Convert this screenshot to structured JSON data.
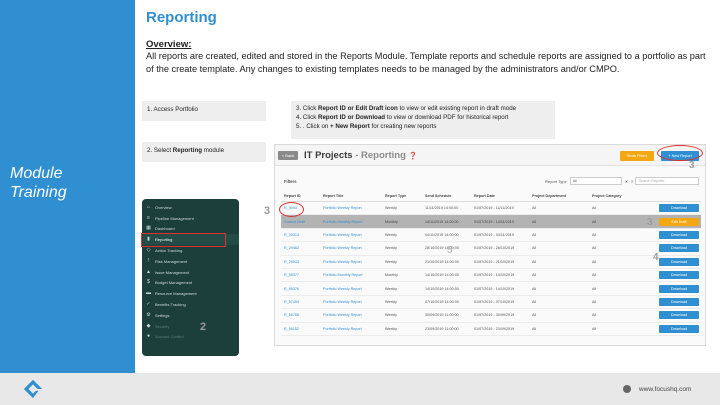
{
  "page": {
    "title": "Reporting",
    "overview_heading": "Overview:",
    "overview_text": "All reports are created, edited and stored in the Reports Module. Template reports and schedule reports are assigned to a portfolio as part of the create template.  Any changes to existing templates needs to be managed by the administrators and/or CMPO."
  },
  "side_label": {
    "line1": "Module",
    "line2": "Training"
  },
  "steps": {
    "step1": "1. Access Portfolio",
    "step2_prefix": "2. Select ",
    "step2_bold": "Reporting",
    "step2_suffix": " module",
    "step3_prefix": "3. Click ",
    "step3_bold": "Report ID or Edit Draft icon",
    "step3_suffix": " to view or edit existing report in draft mode",
    "step4_prefix": "4. Click ",
    "step4_bold": "Report ID or Download",
    "step4_suffix": " to view or download PDF for historical report",
    "step5_prefix": "5. . Click on ",
    "step5_bold": "+ New Report",
    "step5_suffix": " for creating new reports"
  },
  "sidebar": {
    "items": [
      {
        "label": "Overview",
        "icon": "home-icon"
      },
      {
        "label": "Pipeline Management",
        "icon": "pipeline-icon"
      },
      {
        "label": "Dashboard",
        "icon": "dashboard-icon"
      },
      {
        "label": "Reporting",
        "icon": "chart-icon",
        "active": true
      },
      {
        "label": "Action Tracking",
        "icon": "action-icon"
      },
      {
        "label": "Risk Management",
        "icon": "risk-icon"
      },
      {
        "label": "Issue Management",
        "icon": "issue-icon"
      },
      {
        "label": "Budget Management",
        "icon": "budget-icon"
      },
      {
        "label": "Resource Management",
        "icon": "resource-icon"
      },
      {
        "label": "Benefits Tracking",
        "icon": "benefits-icon"
      },
      {
        "label": "Settings",
        "icon": "settings-icon"
      },
      {
        "label": "Security",
        "icon": "security-icon",
        "faded": true
      },
      {
        "label": "Account Control",
        "icon": "account-icon",
        "faded": true
      }
    ]
  },
  "markers": {
    "two": "2",
    "three_left": "3",
    "three_right": "3",
    "three_top": "3",
    "four": "4",
    "five": "5"
  },
  "reporting": {
    "back_label": "< Back",
    "project": "IT Projects",
    "separator": " - ",
    "module": "Reporting",
    "show_filters": "Show Filters",
    "new_report": "+ New Report",
    "filters_label": "Filters",
    "report_type_label": "Report Type",
    "report_type_value": "All",
    "search_placeholder": "Search Reports...",
    "columns": [
      "Report ID",
      "Report Title",
      "Report Type",
      "Send Schedule",
      "Report Date",
      "Project Department",
      "Project Category",
      ""
    ],
    "rows": [
      {
        "id": "R_0004",
        "title": "Portfolio Weekly Report",
        "type": "Weekly",
        "schedule": "11/11/2019 14:00:00",
        "date": "01/07/2019 - 11/11/2019",
        "dept": "All",
        "cat": "All",
        "action": "Download"
      },
      {
        "id": "Current Draft",
        "title": "Portfolio Monthly Report",
        "type": "Monthly",
        "schedule": "14/11/2019 14:00:00",
        "date": "01/07/2019 - 14/11/2019",
        "dept": "All",
        "cat": "All",
        "action": "Edit Draft",
        "draft": true
      },
      {
        "id": "R_00314",
        "title": "Portfolio Weekly Report",
        "type": "Weekly",
        "schedule": "04/11/2019 14:00:00",
        "date": "01/07/2019 - 04/11/2019",
        "dept": "All",
        "cat": "All",
        "action": "Download"
      },
      {
        "id": "R_29462",
        "title": "Portfolio Weekly Report",
        "type": "Weekly",
        "schedule": "28/10/2019 14:00:00",
        "date": "01/07/2019 - 28/10/2019",
        "dept": "All",
        "cat": "All",
        "action": "Download"
      },
      {
        "id": "R_29533",
        "title": "Portfolio Weekly Report",
        "type": "Weekly",
        "schedule": "21/10/2019 14:00:00",
        "date": "01/07/2019 - 21/10/2019",
        "dept": "All",
        "cat": "All",
        "action": "Download"
      },
      {
        "id": "R_58377",
        "title": "Portfolio Monthly Report",
        "type": "Monthly",
        "schedule": "14/10/2019 14:00:00",
        "date": "01/07/2019 - 14/10/2019",
        "dept": "All",
        "cat": "All",
        "action": "Download"
      },
      {
        "id": "R_58376",
        "title": "Portfolio Weekly Report",
        "type": "Weekly",
        "schedule": "14/10/2019 14:00:00",
        "date": "01/07/2019 - 14/10/2019",
        "dept": "All",
        "cat": "All",
        "action": "Download"
      },
      {
        "id": "R_57494",
        "title": "Portfolio Weekly Report",
        "type": "Weekly",
        "schedule": "07/10/2019 14:00:00",
        "date": "01/07/2019 - 07/10/2019",
        "dept": "All",
        "cat": "All",
        "action": "Download"
      },
      {
        "id": "R_56758",
        "title": "Portfolio Weekly Report",
        "type": "Weekly",
        "schedule": "30/09/2019 11:00:00",
        "date": "01/07/2019 - 30/09/2019",
        "dept": "All",
        "cat": "All",
        "action": "Download"
      },
      {
        "id": "R_56152",
        "title": "Portfolio Weekly Report",
        "type": "Weekly",
        "schedule": "23/09/2019 11:00:00",
        "date": "01/07/2019 - 23/09/2019",
        "dept": "All",
        "cat": "All",
        "action": "Download"
      }
    ]
  },
  "footer": {
    "website": "www.focushq.com"
  },
  "colors": {
    "brand_blue": "#2f8fd0",
    "accent_orange": "#f3a712",
    "highlight_red": "#e0312d",
    "sidebar_green": "#1d3f3c"
  }
}
